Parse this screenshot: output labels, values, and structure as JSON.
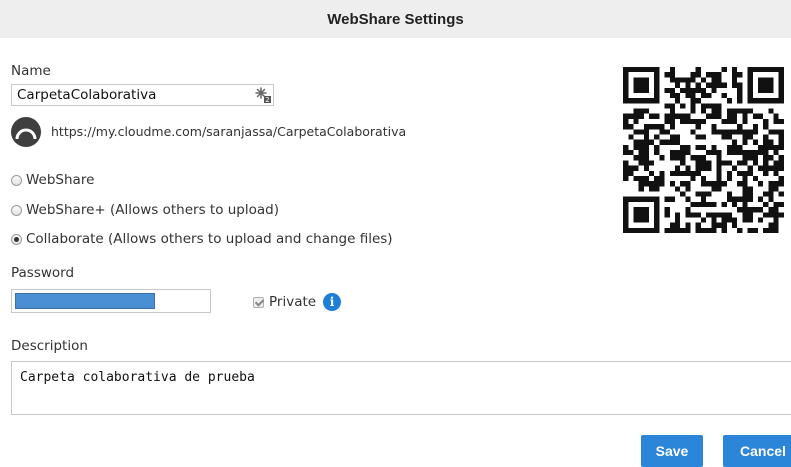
{
  "dialog": {
    "title": "WebShare Settings"
  },
  "name_field": {
    "label": "Name",
    "value": "CarpetaColaborativa",
    "generate_icon": "generate-name-icon"
  },
  "share_link": {
    "icon": "cloudme-logo-icon",
    "url": "https://my.cloudme.com/saranjassa/CarpetaColaborativa"
  },
  "share_options": [
    {
      "label": "WebShare",
      "selected": false
    },
    {
      "label": "WebShare+ (Allows others to upload)",
      "selected": false
    },
    {
      "label": "Collaborate (Allows others to upload and change files)",
      "selected": true
    }
  ],
  "password": {
    "label": "Password",
    "filled": true
  },
  "private": {
    "label": "Private",
    "checked": true,
    "disabled": true,
    "info_icon": "info-icon"
  },
  "description": {
    "label": "Description",
    "value": "Carpeta colaborativa de prueba"
  },
  "buttons": {
    "save": "Save",
    "cancel": "Cancel"
  },
  "colors": {
    "accent": "#2b85d8",
    "password_fill": "#4a8fd4",
    "title_bg": "#eeeeee"
  },
  "qr_code": {
    "icon": "qr-code-icon"
  }
}
